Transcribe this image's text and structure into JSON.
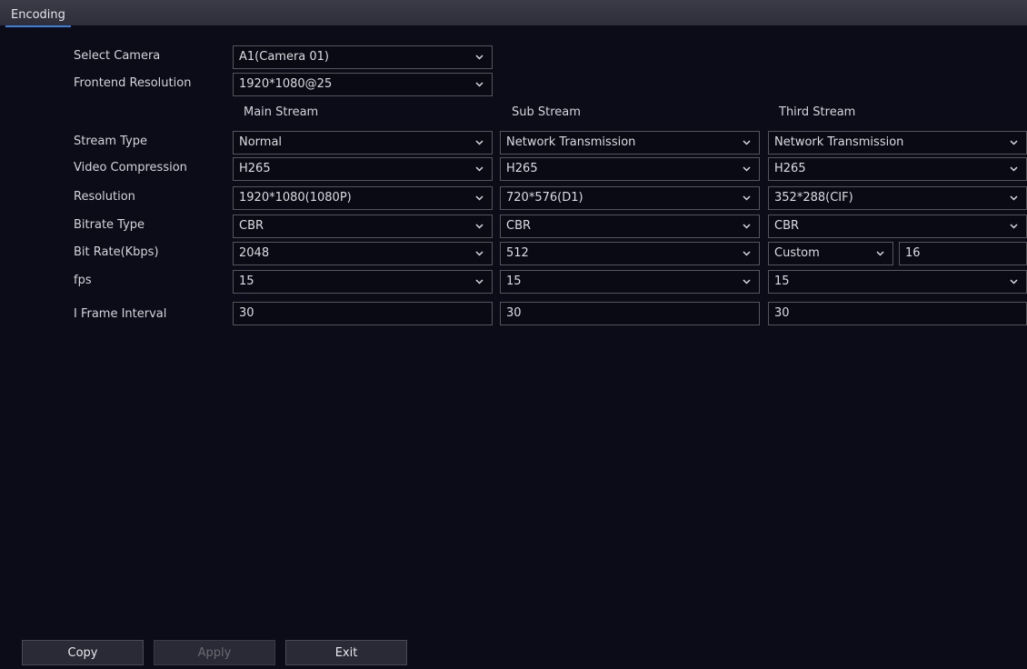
{
  "tab": {
    "label": "Encoding"
  },
  "select_camera": {
    "label": "Select Camera",
    "value": "A1(Camera 01)"
  },
  "frontend_resolution": {
    "label": "Frontend Resolution",
    "value": "1920*1080@25"
  },
  "columns": {
    "main": "Main Stream",
    "sub": "Sub Stream",
    "third": "Third Stream"
  },
  "rows": {
    "stream_type": {
      "label": "Stream Type",
      "main": "Normal",
      "sub": "Network Transmission",
      "third": "Network Transmission"
    },
    "video_compression": {
      "label": "Video Compression",
      "main": "H265",
      "sub": "H265",
      "third": "H265"
    },
    "resolution": {
      "label": "Resolution",
      "main": "1920*1080(1080P)",
      "sub": "720*576(D1)",
      "third": "352*288(CIF)"
    },
    "bitrate_type": {
      "label": "Bitrate Type",
      "main": "CBR",
      "sub": "CBR",
      "third": "CBR"
    },
    "bit_rate": {
      "label": "Bit Rate(Kbps)",
      "main": "2048",
      "sub": "512",
      "third": "Custom",
      "third_custom": "16"
    },
    "fps": {
      "label": "fps",
      "main": "15",
      "sub": "15",
      "third": "15"
    },
    "i_frame_interval": {
      "label": "I Frame Interval",
      "main": "30",
      "sub": "30",
      "third": "30"
    }
  },
  "buttons": {
    "copy": "Copy",
    "apply": "Apply",
    "exit": "Exit"
  },
  "icons": {
    "dropdown": "chevron-down-icon"
  }
}
